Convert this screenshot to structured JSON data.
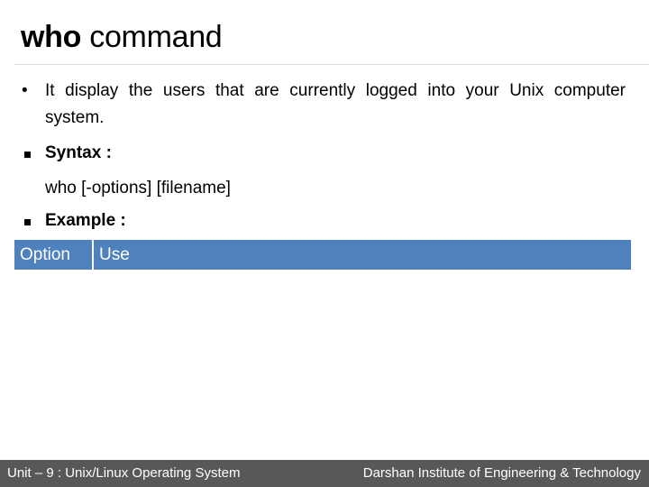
{
  "slide": {
    "title_bold": "who",
    "title_rest": " command",
    "bullets": [
      {
        "icon": "round-bullet",
        "text": "It display the users that are currently logged into your Unix computer system."
      }
    ],
    "syntax": {
      "icon": "square-bullet",
      "label": "Syntax :",
      "command": "who [-options] [filename]"
    },
    "example": {
      "icon": "square-bullet",
      "label": "Example :"
    },
    "table": {
      "columns": [
        "Option",
        "Use"
      ],
      "rows": [],
      "header_color": "#4f81bd"
    }
  },
  "footer": {
    "left": "Unit – 9 : Unix/Linux Operating System",
    "right": "Darshan Institute of Engineering & Technology",
    "background": "#58585a"
  }
}
